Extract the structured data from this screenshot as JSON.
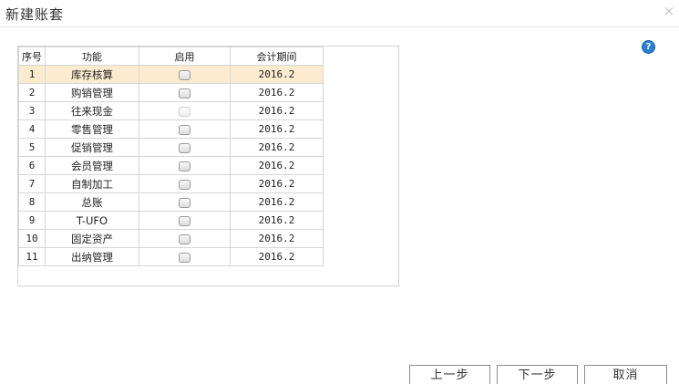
{
  "dialog": {
    "title": "新建账套",
    "close_glyph": "×",
    "help_glyph": "?"
  },
  "table": {
    "headers": [
      "序号",
      "功能",
      "启用",
      "会计期间"
    ],
    "rows": [
      {
        "no": "1",
        "name": "库存核算",
        "enabled": false,
        "disabled": false,
        "period": "2016.2",
        "selected": true
      },
      {
        "no": "2",
        "name": "购销管理",
        "enabled": false,
        "disabled": false,
        "period": "2016.2",
        "selected": false
      },
      {
        "no": "3",
        "name": "往来现金",
        "enabled": false,
        "disabled": true,
        "period": "2016.2",
        "selected": false
      },
      {
        "no": "4",
        "name": "零售管理",
        "enabled": false,
        "disabled": false,
        "period": "2016.2",
        "selected": false
      },
      {
        "no": "5",
        "name": "促销管理",
        "enabled": false,
        "disabled": false,
        "period": "2016.2",
        "selected": false
      },
      {
        "no": "6",
        "name": "会员管理",
        "enabled": false,
        "disabled": false,
        "period": "2016.2",
        "selected": false
      },
      {
        "no": "7",
        "name": "自制加工",
        "enabled": false,
        "disabled": false,
        "period": "2016.2",
        "selected": false
      },
      {
        "no": "8",
        "name": "总账",
        "enabled": false,
        "disabled": false,
        "period": "2016.2",
        "selected": false
      },
      {
        "no": "9",
        "name": "T-UFO",
        "enabled": false,
        "disabled": false,
        "period": "2016.2",
        "selected": false
      },
      {
        "no": "10",
        "name": "固定资产",
        "enabled": false,
        "disabled": false,
        "period": "2016.2",
        "selected": false
      },
      {
        "no": "11",
        "name": "出纳管理",
        "enabled": false,
        "disabled": false,
        "period": "2016.2",
        "selected": false
      }
    ]
  },
  "buttons": {
    "prev": "上一步",
    "next": "下一步",
    "cancel": "取消"
  }
}
